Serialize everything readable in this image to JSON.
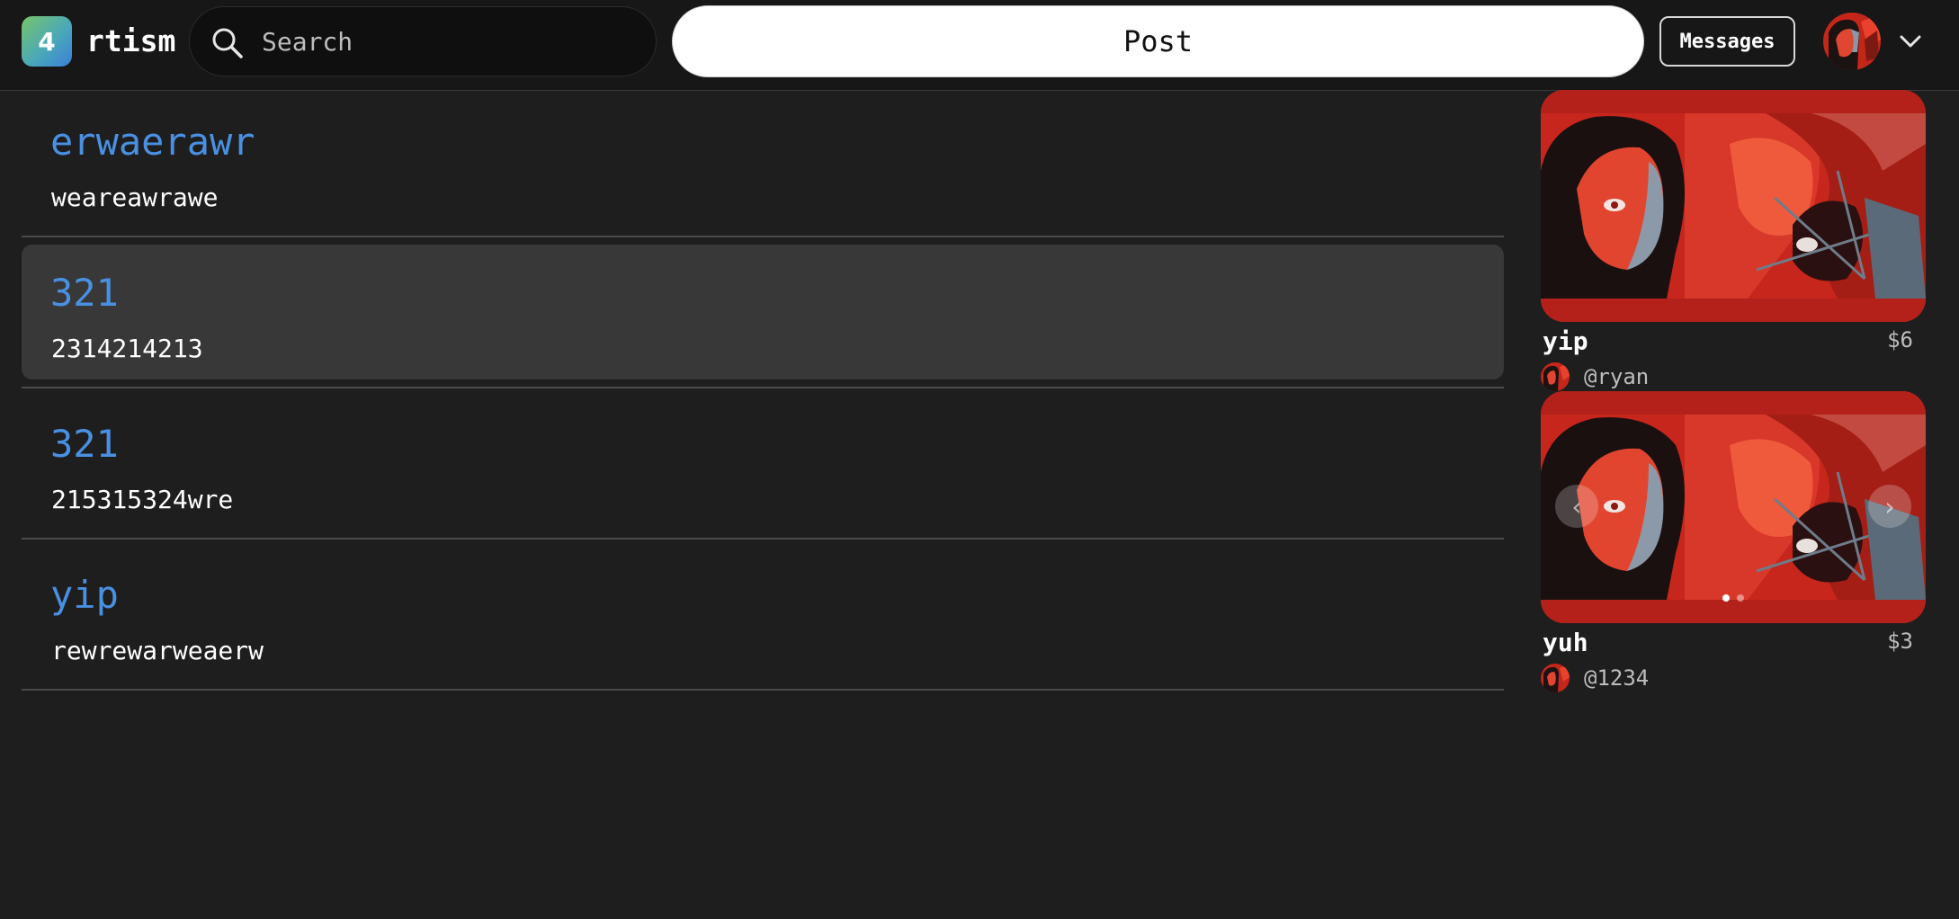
{
  "header": {
    "logo_badge": "4",
    "app_name": "rtism",
    "search_placeholder": "Search",
    "post_label": "Post",
    "messages_label": "Messages"
  },
  "feed": {
    "posts": [
      {
        "title": "erwaerawr",
        "body": "weareawrawe",
        "selected": false
      },
      {
        "title": "321",
        "body": "2314214213",
        "selected": true
      },
      {
        "title": "321",
        "body": "215315324wre",
        "selected": false
      },
      {
        "title": "yip",
        "body": "rewrewarweaerw",
        "selected": false
      }
    ]
  },
  "listings": [
    {
      "title": "yip",
      "price": "$6",
      "seller": "@ryan",
      "images": 1,
      "active_image": 1
    },
    {
      "title": "yuh",
      "price": "$3",
      "seller": "@1234",
      "images": 2,
      "active_image": 1
    }
  ],
  "colors": {
    "background": "#1e1e1e",
    "header": "#171717",
    "accent_link": "#4a90e2",
    "selected_card": "#383838",
    "art_red": "#c7261c"
  }
}
